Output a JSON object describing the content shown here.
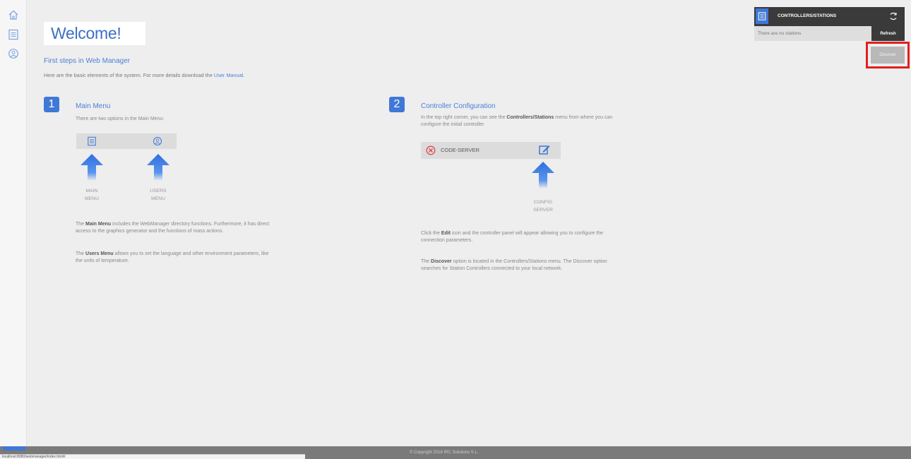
{
  "rail": {
    "items": [
      {
        "icon": "home-icon"
      },
      {
        "icon": "main-menu-icon"
      },
      {
        "icon": "user-menu-icon"
      }
    ]
  },
  "welcome": {
    "title": "Welcome!",
    "first_steps": "First steps in Web Manager",
    "intro_text": "Here are the basic elements of the system. For more details download the",
    "intro_link": "User Manual",
    "intro_end": "."
  },
  "section1": {
    "number": "1",
    "title": "Main Menu",
    "subtitle": "There are two options in the Main Menu:",
    "arrow_main_line1": "MAIN",
    "arrow_main_line2": "MENU",
    "arrow_users_line1": "USERS",
    "arrow_users_line2": "MENU",
    "p1_bold": "Main Menu",
    "p1_text_a": " includes the WebManager directory functions. Furthermore, it has direct",
    "p1_text_b": "access to the graphics generator and the functions of mass actions.",
    "p1_prefix": "The ",
    "p2_prefix": "The ",
    "p2_bold": "Users Menu",
    "p2_text_a": " allows you to set the language and other environment parameters, like",
    "p2_text_b": "the units of temperature."
  },
  "section2": {
    "number": "2",
    "title": "Controller Configuration",
    "sub_a": "In the top right corner, you can see the ",
    "sub_bold": "Controllers/Stations",
    "sub_b": " menu from where you can",
    "sub_c": "configure the initial controller.",
    "ctrl_name": "CODE-SERVER",
    "arrow_line1": "CONFIG",
    "arrow_line2": "SERVER",
    "p1_a": "Click the ",
    "p1_bold": "Edit",
    "p1_b": " icon and the controller panel will appear allowing you to configure the",
    "p1_c": "connection parameters.",
    "p2_a": "The ",
    "p2_bold": "Discover",
    "p2_b": " option is located in the Controllers/Stations menu. The Discover option",
    "p2_c": "searches for Station Controllers connected to your local network."
  },
  "controllers_panel": {
    "title": "CONTROLLERS/STATIONS",
    "empty_text": "There are no stations",
    "refresh_label": "Refresh",
    "discover_label": "Discover"
  },
  "footer": {
    "copyright": "© Copyright 2018 IRC Solutions S.L.",
    "status_url": "localhost:8080/webmanager/index.html#"
  },
  "colors": {
    "accent": "#3f78d6",
    "highlight": "#e02020",
    "dark": "#3a3a3a"
  }
}
